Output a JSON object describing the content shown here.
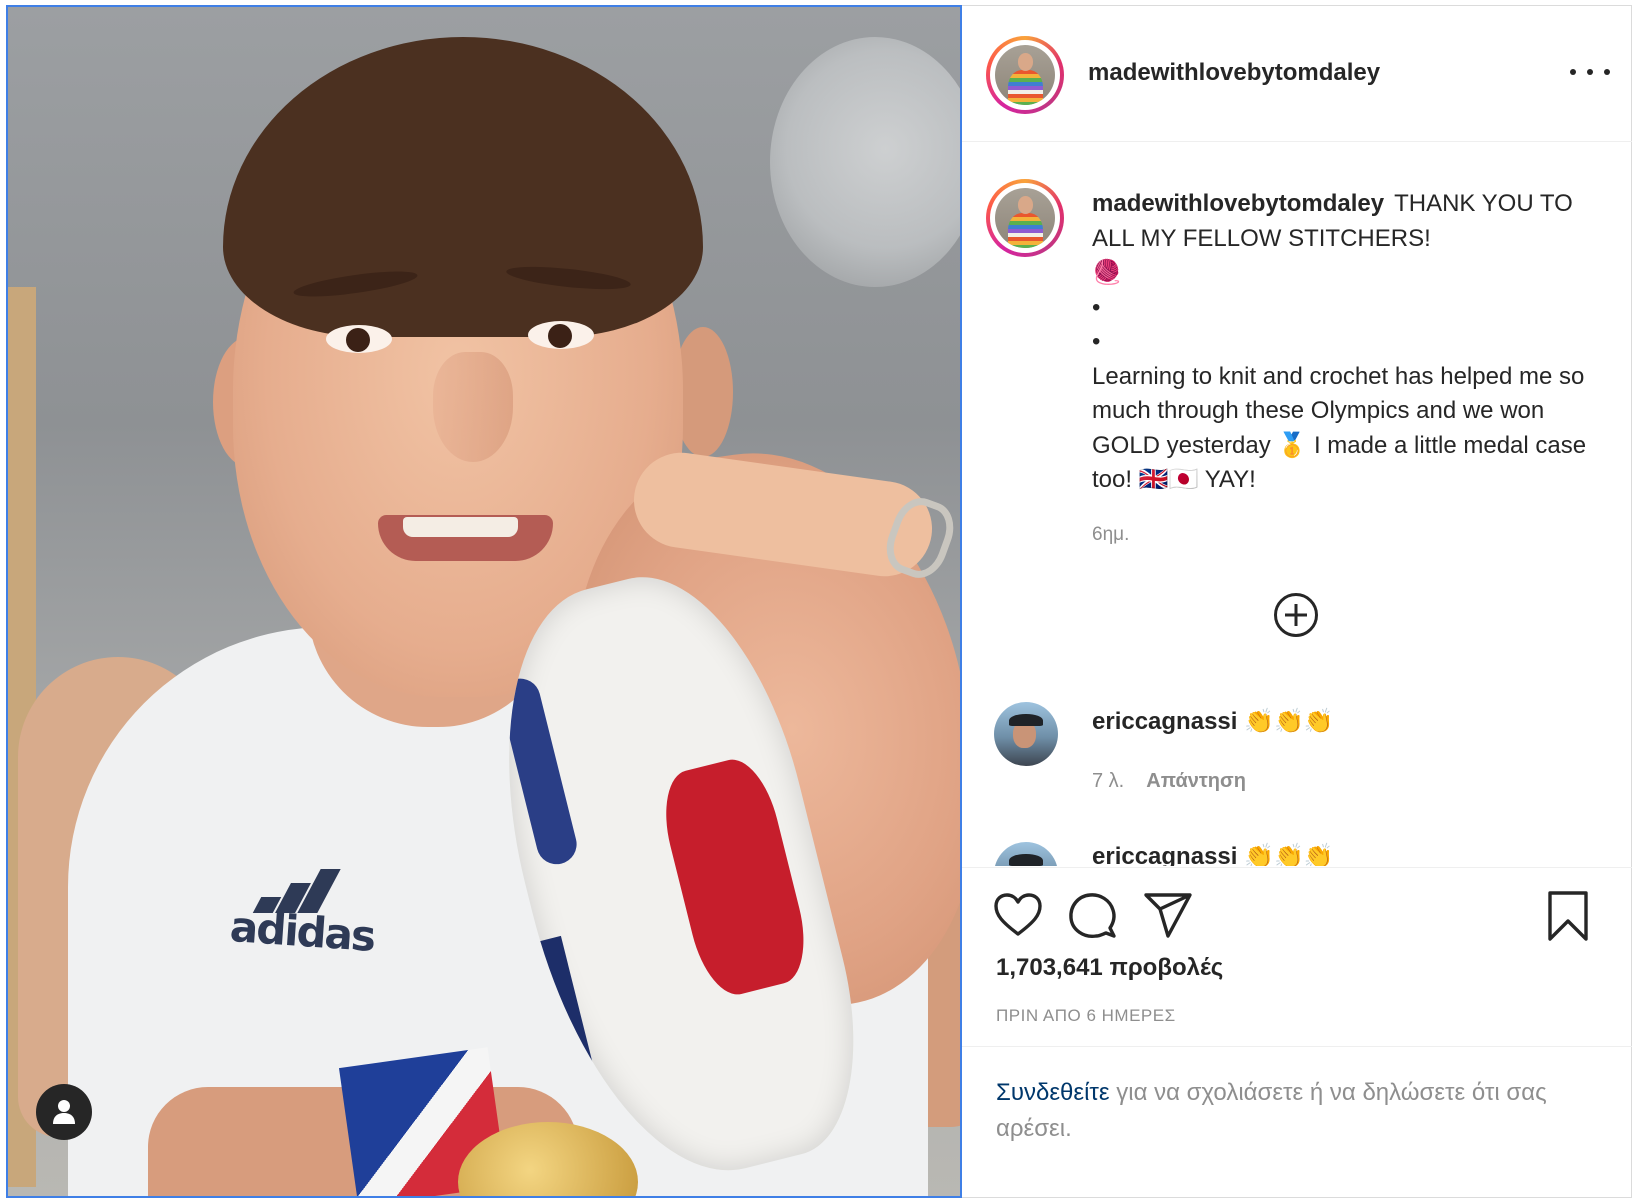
{
  "post": {
    "username": "madewithlovebytomdaley",
    "more_label": "..."
  },
  "media": {
    "shirt_logo": "adidas",
    "user_badge_icon": "person-icon"
  },
  "caption": {
    "username": "madewithlovebytomdaley",
    "lines": [
      "THANK YOU TO ALL MY FELLOW STITCHERS!",
      "🧶",
      "•",
      "•",
      "Learning to knit and crochet has helped me so much through these Olympics and we won GOLD yesterday 🥇 I made a little medal case too! 🇬🇧🇯🇵 YAY!"
    ],
    "time": "6ημ."
  },
  "comments": [
    {
      "username": "ericcagnassi",
      "text": "👏👏👏",
      "time": "7 λ.",
      "reply_label": "Απάντηση"
    },
    {
      "username": "ericcagnassi",
      "text": "👏👏👏"
    }
  ],
  "actions": {
    "views": "1,703,641 προβολές",
    "posted_ago": "ΠΡΙΝ ΑΠΟ 6 ΗΜΕΡΕΣ"
  },
  "login_prompt": {
    "link": "Συνδεθείτε",
    "rest": " για να σχολιάσετε ή να δηλώσετε ότι σας αρέσει."
  },
  "colors": {
    "border": "#dbdbdb",
    "text": "#262626",
    "secondary": "#8e8e8e",
    "link": "#00376b",
    "media_focus_border": "#3f7fe6"
  }
}
